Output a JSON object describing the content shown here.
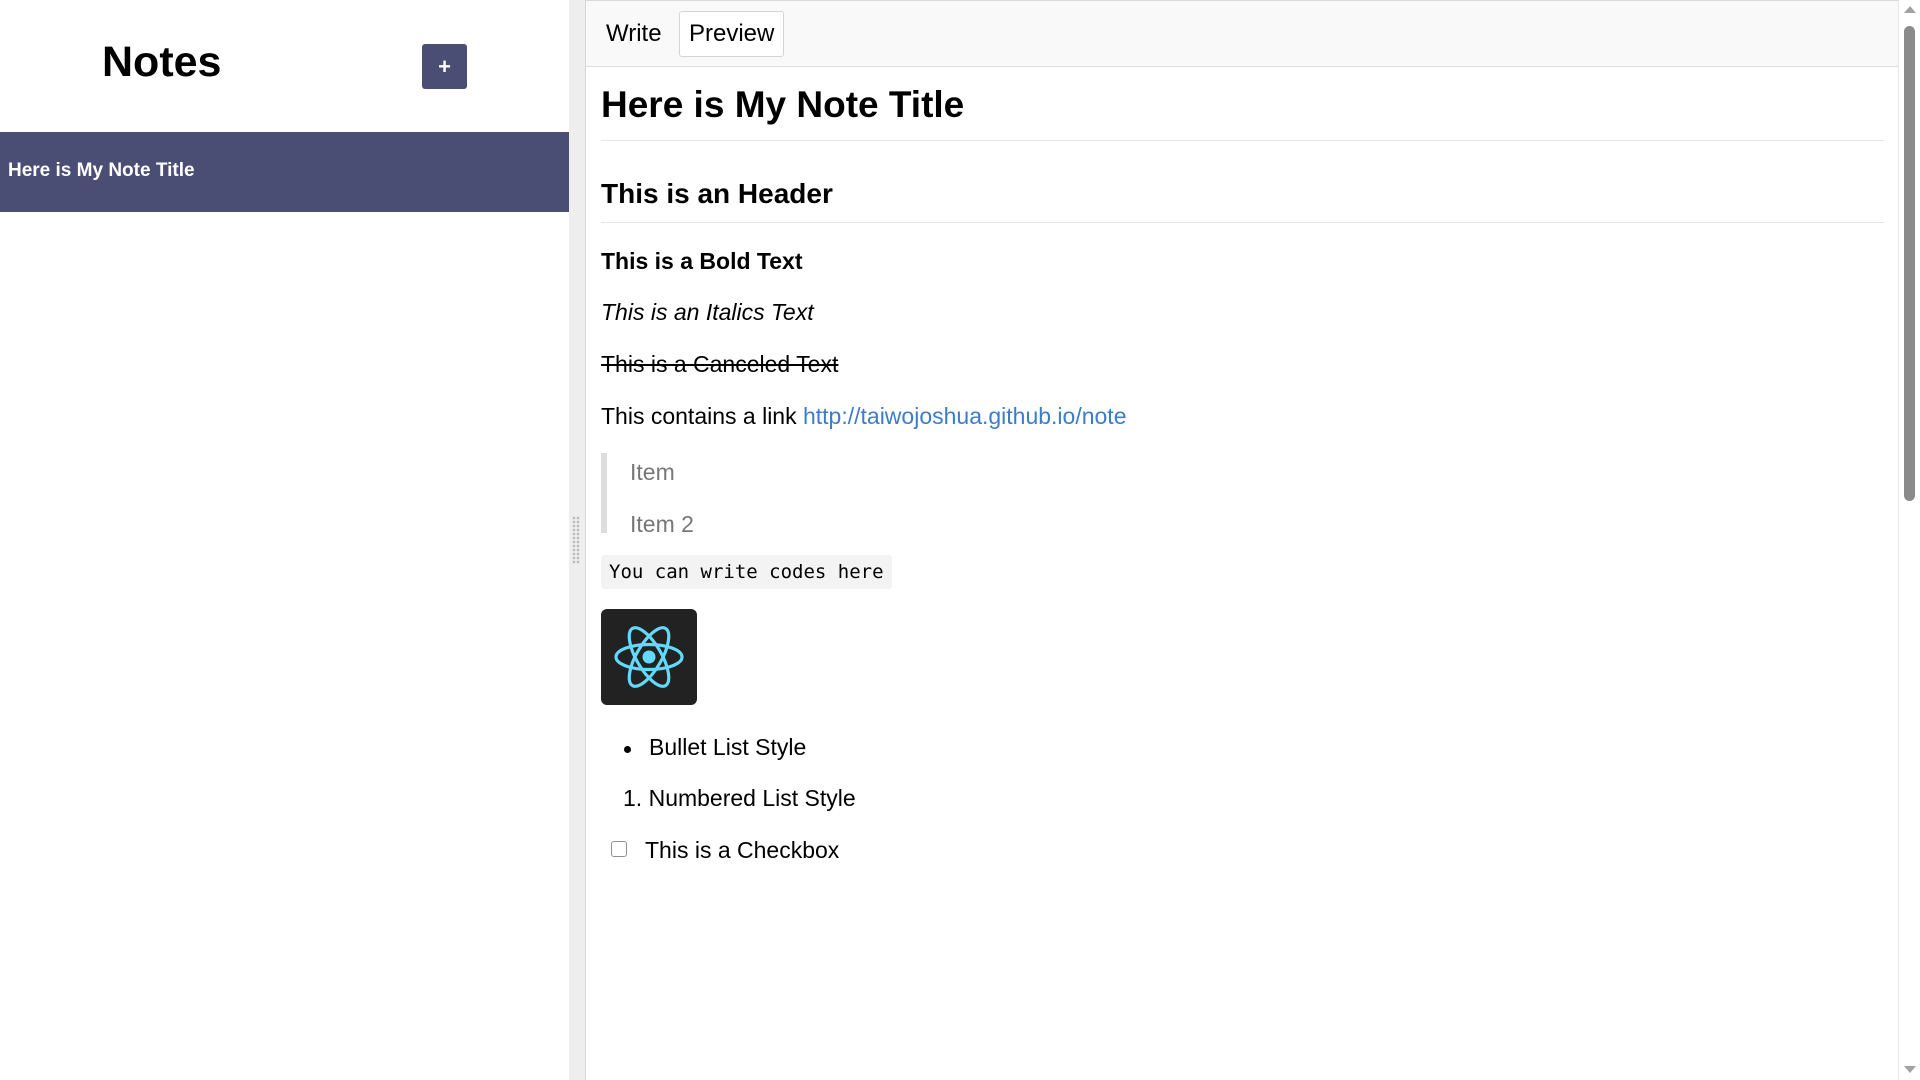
{
  "sidebar": {
    "title": "Notes",
    "new_note_label": "+",
    "notes": [
      {
        "title": "Here is My Note Title"
      }
    ]
  },
  "editor": {
    "tabs": {
      "write": "Write",
      "preview": "Preview"
    },
    "preview": {
      "h1": "Here is My Note Title",
      "h2": "This is an Header",
      "bold": "This is a Bold Text",
      "italic": "This is an Italics Text",
      "strikethrough": "This is a Canceled Text",
      "link_prefix": "This contains a link",
      "link_text": "http://taiwojoshua.github.io/note",
      "blockquote_items": [
        "Item",
        "Item 2"
      ],
      "code": "You can write codes here",
      "image_icon": "react-logo-icon",
      "bullet_item": "Bullet List Style",
      "numbered_marker": "1.",
      "numbered_item": "Numbered List Style",
      "checkbox_label": "This is a Checkbox"
    }
  },
  "colors": {
    "accent": "#4a4e74",
    "link": "#3d7cc9",
    "react": "#61dafb"
  }
}
